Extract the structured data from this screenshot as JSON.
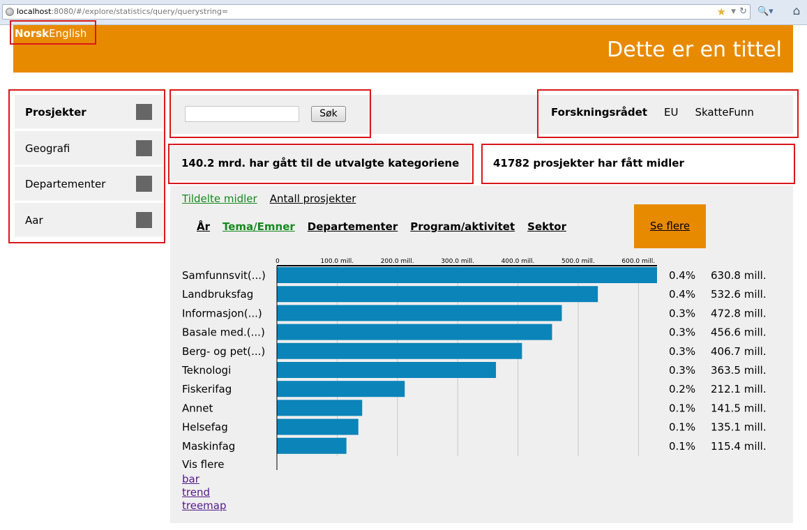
{
  "browser": {
    "url_host": "localhost",
    "url_path": ":8080/#/explore/statistics/query/querystring="
  },
  "header": {
    "lang_norsk": "Norsk",
    "lang_english": "English",
    "title": "Dette er en tittel",
    "accent_color": "#e88a00"
  },
  "sidebar": {
    "items": [
      {
        "label": "Prosjekter",
        "active": true
      },
      {
        "label": "Geografi",
        "active": false
      },
      {
        "label": "Departementer",
        "active": false
      },
      {
        "label": "Aar",
        "active": false
      }
    ]
  },
  "search": {
    "value": "",
    "button_label": "Søk"
  },
  "funders": {
    "items": [
      "Forskningsrådet",
      "EU",
      "SkatteFunn"
    ],
    "active": "Forskningsrådet"
  },
  "summary": {
    "total_text": "140.2 mrd. har gått til de utvalgte kategoriene",
    "count_text": "41782 prosjekter har fått midler"
  },
  "measures": {
    "items": [
      "Tildelte midler",
      "Antall prosjekter"
    ],
    "active": "Tildelte midler"
  },
  "dimensions": {
    "items": [
      "År",
      "Tema/Emner",
      "Departementer",
      "Program/aktivitet",
      "Sektor"
    ],
    "active": "Tema/Emner",
    "more_label": "Se flere"
  },
  "chart_data": {
    "type": "bar",
    "orientation": "horizontal",
    "categories": [
      "Samfunnsvit(...)",
      "Landbruksfag",
      "Informasjon(...)",
      "Basale med.(...)",
      "Berg- og pet(...)",
      "Teknologi",
      "Fiskerifag",
      "Annet",
      "Helsefag",
      "Maskinfag"
    ],
    "values": [
      630.8,
      532.6,
      472.8,
      456.6,
      406.7,
      363.5,
      212.1,
      141.5,
      135.1,
      115.4
    ],
    "percent_labels": [
      "0.4%",
      "0.4%",
      "0.3%",
      "0.3%",
      "0.3%",
      "0.3%",
      "0.2%",
      "0.1%",
      "0.1%",
      "0.1%"
    ],
    "value_labels": [
      "630.8 mill.",
      "532.6 mill.",
      "472.8 mill.",
      "456.6 mill.",
      "406.7 mill.",
      "363.5 mill.",
      "212.1 mill.",
      "141.5 mill.",
      "135.1 mill.",
      "115.4 mill."
    ],
    "ticks": [
      0,
      100,
      200,
      300,
      400,
      500,
      600
    ],
    "tick_labels": [
      "0",
      "100.0 mill.",
      "200.0 mill.",
      "300.0 mill.",
      "400.0 mill.",
      "500.0 mill.",
      "600.0 mill."
    ],
    "xlim": [
      0,
      630.8
    ],
    "axis_position": "top",
    "grid": true,
    "bar_color": "#0b84b9"
  },
  "footer": {
    "show_more": "Vis flere",
    "views": [
      "bar",
      "trend",
      "treemap"
    ]
  }
}
